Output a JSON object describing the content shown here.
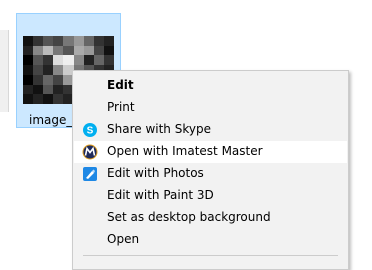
{
  "file": {
    "label": "image_5"
  },
  "context_menu": {
    "items": [
      {
        "label": "Edit",
        "icon": "",
        "bold": true
      },
      {
        "label": "Print",
        "icon": ""
      },
      {
        "label": "Share with Skype",
        "icon": "skype-icon"
      },
      {
        "label": "Open with Imatest Master",
        "icon": "imatest-icon",
        "highlighted": true
      },
      {
        "label": "Edit with Photos",
        "icon": "photos-icon"
      },
      {
        "label": "Edit with Paint 3D",
        "icon": ""
      },
      {
        "label": "Set as desktop background",
        "icon": ""
      },
      {
        "label": "Open",
        "icon": ""
      }
    ]
  },
  "colors": {
    "selection_bg": "#cce8ff",
    "selection_border": "#99d1ff",
    "menu_bg": "#f2f2f2",
    "menu_hover": "#ffffff",
    "skype_blue": "#00aff0",
    "imatest_navy": "#1f2a5a",
    "photos_blue": "#1e88e5"
  }
}
